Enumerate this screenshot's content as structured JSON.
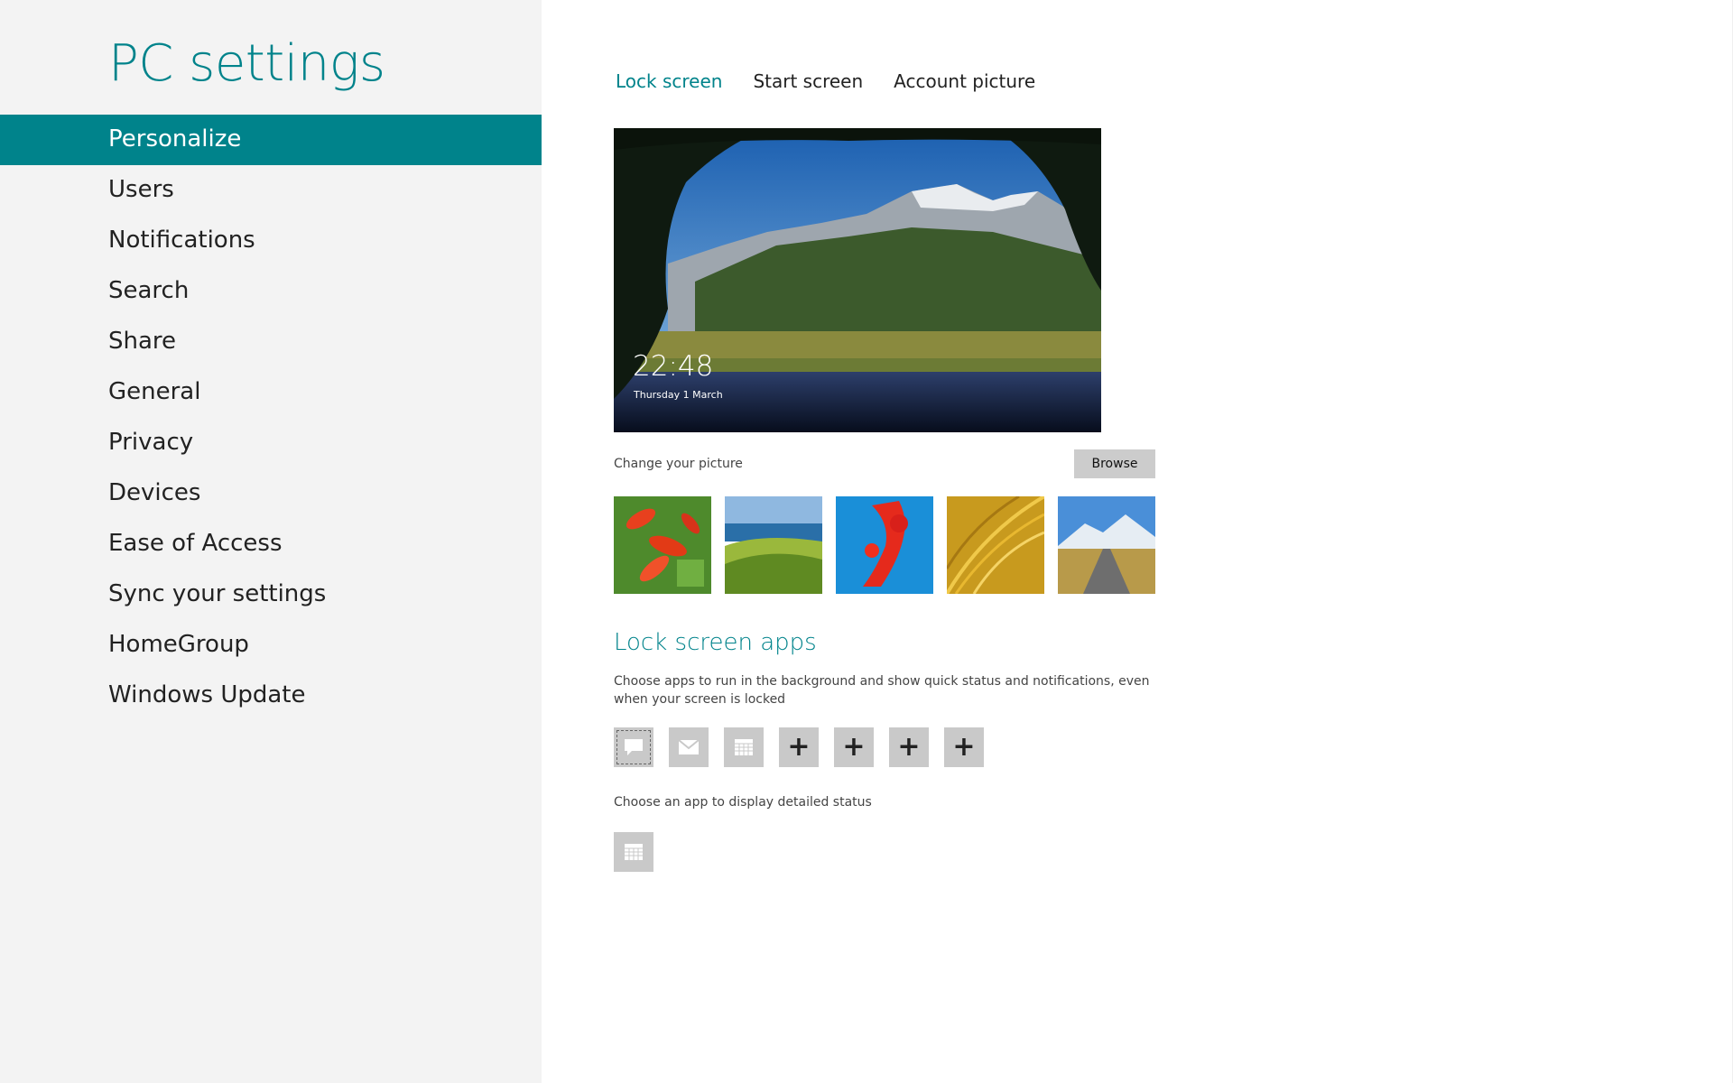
{
  "app": {
    "title": "PC settings"
  },
  "sidebar": {
    "items": [
      {
        "label": "Personalize",
        "active": true
      },
      {
        "label": "Users"
      },
      {
        "label": "Notifications"
      },
      {
        "label": "Search"
      },
      {
        "label": "Share"
      },
      {
        "label": "General"
      },
      {
        "label": "Privacy"
      },
      {
        "label": "Devices"
      },
      {
        "label": "Ease of Access"
      },
      {
        "label": "Sync your settings"
      },
      {
        "label": "HomeGroup"
      },
      {
        "label": "Windows Update"
      }
    ]
  },
  "tabs": [
    {
      "label": "Lock screen",
      "active": true
    },
    {
      "label": "Start screen"
    },
    {
      "label": "Account picture"
    }
  ],
  "preview": {
    "time": "22:48",
    "date": "Thursday 1 March"
  },
  "picture": {
    "change_label": "Change your picture",
    "browse_label": "Browse",
    "thumbnails": [
      "red-flowers",
      "coastal-hills",
      "red-coral",
      "golden-grass",
      "mountain-road"
    ]
  },
  "lock_apps": {
    "title": "Lock screen apps",
    "description": "Choose apps to run in the background and show quick status and notifications, even when your screen is locked",
    "slots": [
      {
        "icon": "messaging-icon",
        "selected": true
      },
      {
        "icon": "mail-icon"
      },
      {
        "icon": "calendar-icon"
      },
      {
        "icon": "add-icon"
      },
      {
        "icon": "add-icon"
      },
      {
        "icon": "add-icon"
      },
      {
        "icon": "add-icon"
      }
    ],
    "detail_label": "Choose an app to display detailed status",
    "detail_icon": "calendar-icon"
  },
  "colors": {
    "accent": "#00838b",
    "sidebar_bg": "#f3f3f3",
    "tile_bg": "#c9c9c9"
  }
}
